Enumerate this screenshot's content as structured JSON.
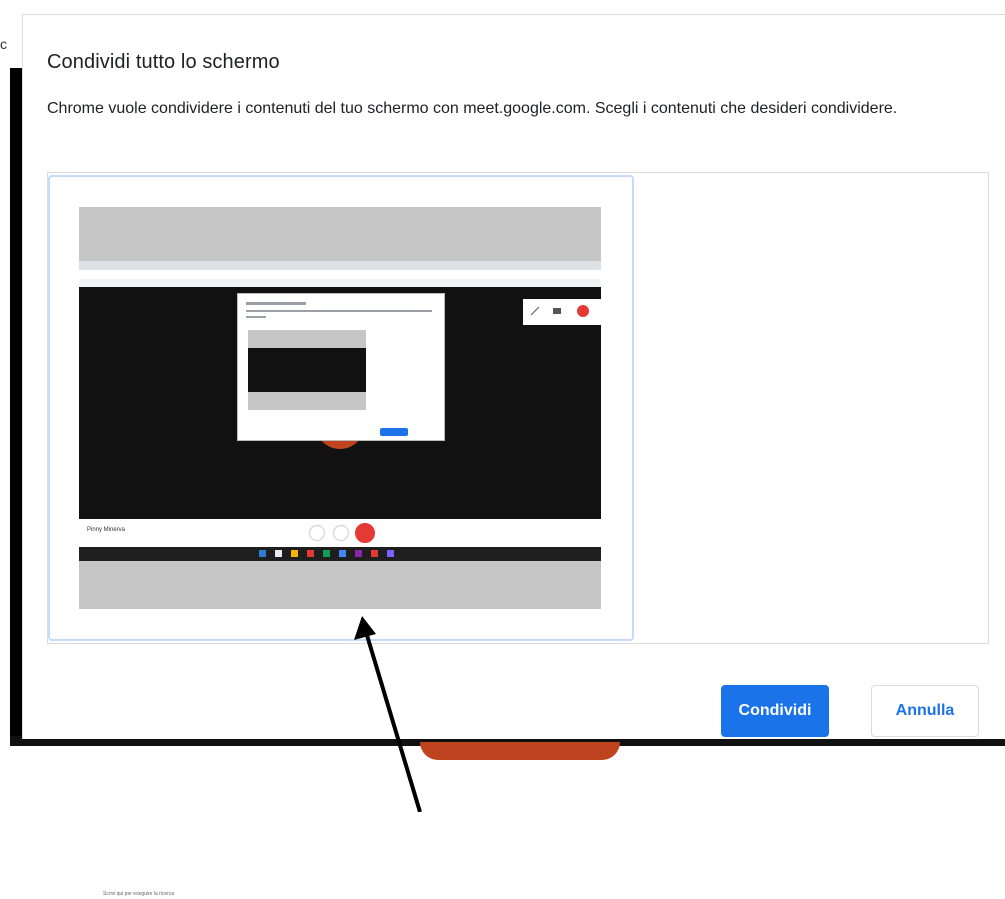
{
  "background": {
    "cut_letter": "c"
  },
  "dialog": {
    "title": "Condividi tutto lo schermo",
    "description": "Chrome vuole condividere i contenuti del tuo schermo con meet.google.com. Scegli i contenuti che desideri condividere.",
    "buttons": {
      "share_label": "Condividi",
      "cancel_label": "Annulla"
    },
    "colors": {
      "accent": "#1a73e8",
      "selection_border": "#c6dafc"
    }
  },
  "thumbnail": {
    "inner_title": "Condividi tutto lo schermo",
    "participant_name": "Pinny Minerva",
    "taskbar_search": "Scrivi qui per eseguire la ricerca"
  },
  "annotation": {
    "arrow_color": "#000000"
  }
}
